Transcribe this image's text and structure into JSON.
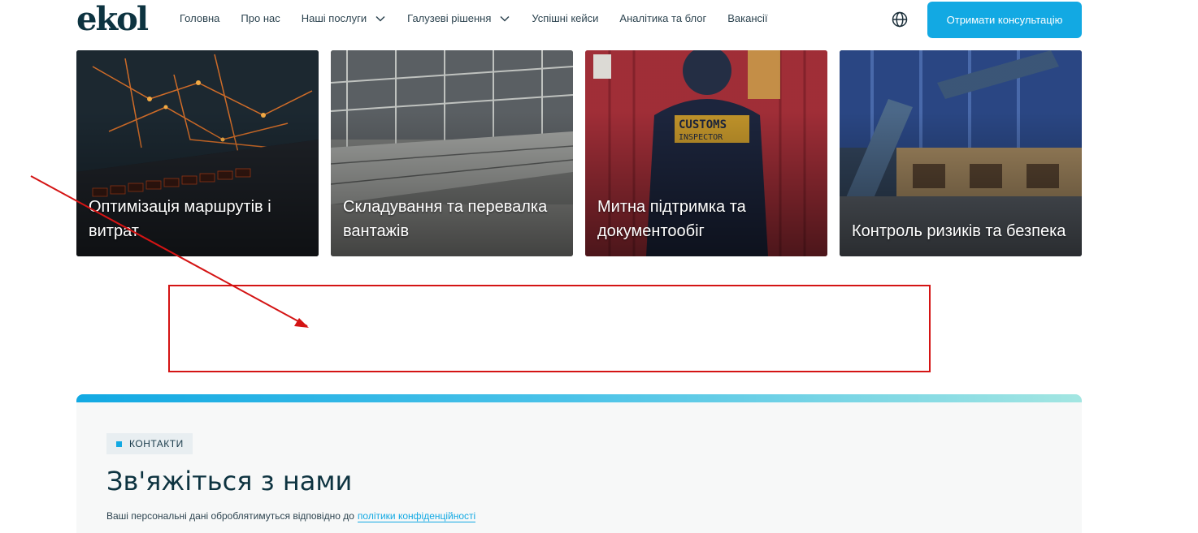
{
  "header": {
    "logo": "ekol",
    "nav": [
      {
        "label": "Головна"
      },
      {
        "label": "Про нас"
      },
      {
        "label": "Наші послуги",
        "has_dropdown": true
      },
      {
        "label": "Галузеві рішення",
        "has_dropdown": true
      },
      {
        "label": "Успішні кейси"
      },
      {
        "label": "Аналітика та блог"
      },
      {
        "label": "Вакансії"
      }
    ],
    "globe_icon": "globe-icon",
    "cta_label": "Отримати консультацію",
    "accent": "#12a9e3"
  },
  "cards": [
    {
      "title": "Оптимізація маршрутів і витрат",
      "image": "laptop-with-map"
    },
    {
      "title": "Складування та перевалка вантажів",
      "image": "warehouse-conveyors"
    },
    {
      "title": "Митна підтримка та документообіг",
      "image": "customs-inspector"
    },
    {
      "title": "Контроль ризиків та безпека",
      "image": "strapped-pallets"
    }
  ],
  "contacts": {
    "badge": "КОНТАКТИ",
    "heading": "Зв'яжіться з нами",
    "note_text": "Ваші персональні дані оброблятимуться відповідно до",
    "note_link": "політики конфіденційності"
  },
  "annotation_color": "#d41414"
}
